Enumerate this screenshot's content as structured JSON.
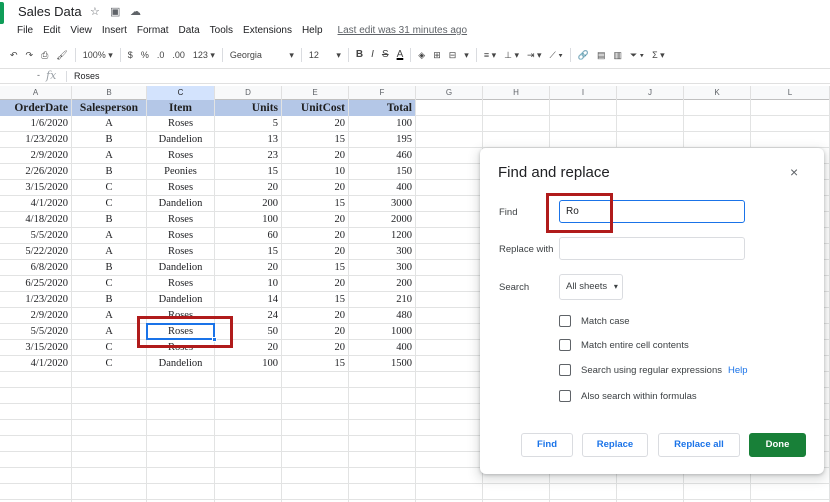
{
  "title_bar": {
    "doc_title": "Sales Data"
  },
  "menu": {
    "items": [
      "File",
      "Edit",
      "View",
      "Insert",
      "Format",
      "Data",
      "Tools",
      "Extensions",
      "Help"
    ],
    "last_edit": "Last edit was 31 minutes ago"
  },
  "toolbar": {
    "zoom": "100%",
    "currency": "$",
    "percent": "%",
    "decimal_decrease": ".0",
    "decimal_increase": ".00",
    "more_formats": "123",
    "font": "Georgia",
    "font_size": "12",
    "bold": "B",
    "italic": "I",
    "strikethrough": "S",
    "text_color": "A"
  },
  "formula_bar": {
    "cell_ref": "-",
    "fx": "fx",
    "value": "Roses"
  },
  "columns": [
    "A",
    "B",
    "C",
    "D",
    "E",
    "F",
    "G",
    "H",
    "I",
    "J",
    "K",
    "L"
  ],
  "headers": [
    "OrderDate",
    "Salesperson",
    "Item",
    "Units",
    "UnitCost",
    "Total"
  ],
  "rows": [
    [
      "1/6/2020",
      "A",
      "Roses",
      "5",
      "20",
      "100"
    ],
    [
      "1/23/2020",
      "B",
      "Dandelion",
      "13",
      "15",
      "195"
    ],
    [
      "2/9/2020",
      "A",
      "Roses",
      "23",
      "20",
      "460"
    ],
    [
      "2/26/2020",
      "B",
      "Peonies",
      "15",
      "10",
      "150"
    ],
    [
      "3/15/2020",
      "C",
      "Roses",
      "20",
      "20",
      "400"
    ],
    [
      "4/1/2020",
      "C",
      "Dandelion",
      "200",
      "15",
      "3000"
    ],
    [
      "4/18/2020",
      "B",
      "Roses",
      "100",
      "20",
      "2000"
    ],
    [
      "5/5/2020",
      "A",
      "Roses",
      "60",
      "20",
      "1200"
    ],
    [
      "5/22/2020",
      "A",
      "Roses",
      "15",
      "20",
      "300"
    ],
    [
      "6/8/2020",
      "B",
      "Dandelion",
      "20",
      "15",
      "300"
    ],
    [
      "6/25/2020",
      "C",
      "Roses",
      "10",
      "20",
      "200"
    ],
    [
      "1/23/2020",
      "B",
      "Dandelion",
      "14",
      "15",
      "210"
    ],
    [
      "2/9/2020",
      "A",
      "Roses",
      "24",
      "20",
      "480"
    ],
    [
      "5/5/2020",
      "A",
      "Roses",
      "50",
      "20",
      "1000"
    ],
    [
      "3/15/2020",
      "C",
      "Roses",
      "20",
      "20",
      "400"
    ],
    [
      "4/1/2020",
      "C",
      "Dandelion",
      "100",
      "15",
      "1500"
    ]
  ],
  "dialog": {
    "title": "Find and replace",
    "close": "×",
    "find_label": "Find",
    "find_value": "Ro",
    "replace_label": "Replace with",
    "replace_value": "",
    "search_label": "Search",
    "search_scope": "All sheets",
    "options": [
      "Match case",
      "Match entire cell contents",
      "Search using regular expressions",
      "Also search within formulas"
    ],
    "help_link": "Help",
    "buttons": {
      "find": "Find",
      "replace": "Replace",
      "replace_all": "Replace all",
      "done": "Done"
    }
  },
  "colors": {
    "header_fill": "#b4c7e7",
    "selection": "#1a73e8",
    "highlight_box": "#b01b1b",
    "done_button": "#188038"
  }
}
